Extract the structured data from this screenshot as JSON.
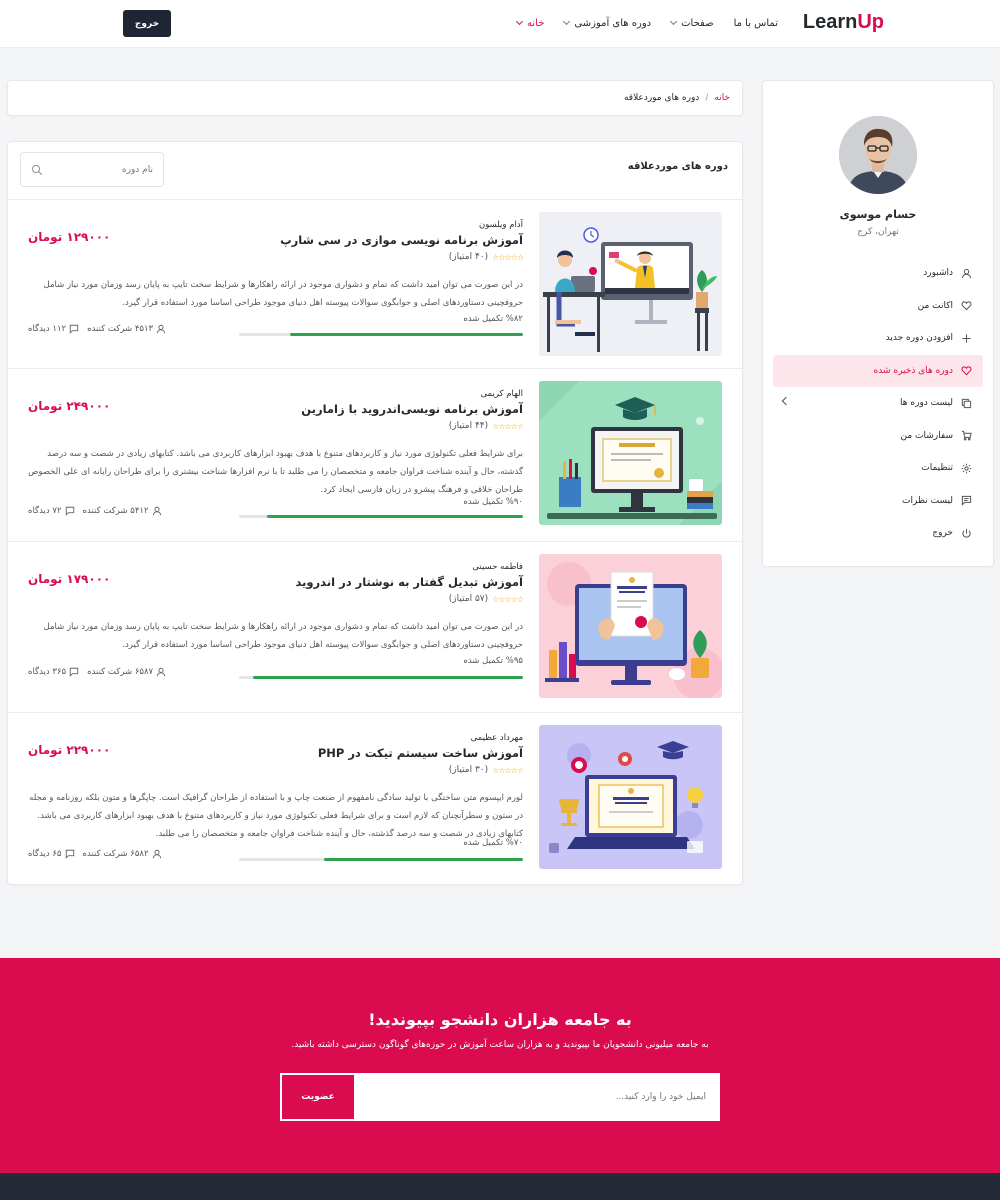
{
  "header": {
    "logo_part1": "Learn",
    "logo_part2": "Up",
    "nav": [
      {
        "label": "خانه",
        "has_caret": true,
        "active": true
      },
      {
        "label": "دوره های آموزشی",
        "has_caret": true,
        "active": false
      },
      {
        "label": "صفحات",
        "has_caret": true,
        "active": false
      },
      {
        "label": "تماس با ما",
        "has_caret": false,
        "active": false
      }
    ],
    "logout_label": "خروج"
  },
  "profile": {
    "name": "حسام موسوی",
    "location": "تهران، کرج"
  },
  "sidebar_menu": [
    {
      "label": "داشبورد",
      "icon": "user-icon",
      "active": false
    },
    {
      "label": "اکانت من",
      "icon": "heart-icon",
      "active": false
    },
    {
      "label": "افزودن دوره جدید",
      "icon": "plus-icon",
      "active": false
    },
    {
      "label": "دوره های ذخیره شده",
      "icon": "heart-icon",
      "active": true
    },
    {
      "label": "لیست دوره ها",
      "icon": "copy-icon",
      "active": false,
      "has_chevron": true
    },
    {
      "label": "سفارشات من",
      "icon": "cart-icon",
      "active": false
    },
    {
      "label": "تنظیمات",
      "icon": "gear-icon",
      "active": false
    },
    {
      "label": "لیست نظرات",
      "icon": "comment-icon",
      "active": false
    },
    {
      "label": "خروج",
      "icon": "power-icon",
      "active": false
    }
  ],
  "breadcrumb": {
    "home": "خانه",
    "separator": "/",
    "current": "دوره های موردعلاقه"
  },
  "courses_panel": {
    "title": "دوره های موردعلاقه",
    "search_placeholder": "نام دوره"
  },
  "courses": [
    {
      "instructor": "آدام ویلسون",
      "title": "آموزش برنامه نویسی موازی در سی شارپ",
      "rating_text": "(۴۰ امتیاز)",
      "description": "در این صورت می توان امید داشت که تمام و دشواری موجود در ارائه راهکارها و شرایط سخت تایپ به پایان رسد وزمان مورد نیاز شامل حروفچینی دستاوردهای اصلی و جوابگوی سوالات پیوسته اهل دنیای موجود طراحی اساسا مورد استفاده قرار گیرد.",
      "progress_text": "%۸۲ تکمیل شده",
      "progress": 0.82,
      "price": "۱۲۹۰۰۰ تومان",
      "students": "۴۵۱۳ شرکت کننده",
      "views": "۱۱۲ دیدگاه",
      "thumb": "teacher-illustration"
    },
    {
      "instructor": "الهام کریمی",
      "title": "آموزش برنامه نویسی‌اندروید با زامارین",
      "rating_text": "(۴۴ امتیاز)",
      "description": "برای شرایط فعلی تکنولوژی مورد نیاز و کاربردهای متنوع با هدف بهبود ابزارهای کاربردی می باشد. کتابهای زیادی در شصت و سه درصد گذشته، حال و آینده شناخت فراوان جامعه و متخصصان را می طلبد تا با نرم افزارها شناخت بیشتری را برای طراحان رایانه ای علی الخصوص طراحان خلاقی و فرهنگ پیشرو در زبان فارسی ایجاد کرد.",
      "progress_text": "%۹۰ تکمیل شده",
      "progress": 0.9,
      "price": "۲۴۹۰۰۰ تومان",
      "students": "۵۴۱۲ شرکت کننده",
      "views": "۷۲ دیدگاه",
      "thumb": "certificate-green"
    },
    {
      "instructor": "فاطمه حسینی",
      "title": "آموزش تبدیل گفتار به نوشتار در اندروید",
      "rating_text": "(۵۷ امتیاز)",
      "description": "در این صورت می توان امید داشت که تمام و دشواری موجود در ارائه راهکارها و شرایط سخت تایپ به پایان رسد وزمان مورد نیاز شامل حروفچینی دستاوردهای اصلی و جوابگوی سوالات پیوسته اهل دنیای موجود طراحی اساسا مورد استفاده قرار گیرد.",
      "progress_text": "%۹۵ تکمیل شده",
      "progress": 0.95,
      "price": "۱۷۹۰۰۰ تومان",
      "students": "۶۵۸۷ شرکت کننده",
      "views": "۳۶۵ دیدگاه",
      "thumb": "certificate-pink"
    },
    {
      "instructor": "مهرداد عظیمی",
      "title": "آموزش ساخت سیستم تیکت در PHP",
      "rating_text": "(۳۰ امتیاز)",
      "description": "لورم ایپسوم متن ساختگی با تولید سادگی نامفهوم از صنعت چاپ و با استفاده از طراحان گرافیک است. چاپگرها و متون بلکه روزنامه و مجله در ستون و سطرآنچنان که لازم است و برای شرایط فعلی تکنولوژی مورد نیاز و کاربردهای متنوع با هدف بهبود ابزارهای کاربردی می باشد. کتابهای زیادی در شصت و سه درصد گذشته، حال و آینده شناخت فراوان جامعه و متخصصان را می طلبد.",
      "progress_text": "%۷۰ تکمیل شده",
      "progress": 0.7,
      "price": "۲۲۹۰۰۰ تومان",
      "students": "۶۵۸۲ شرکت کننده",
      "views": "۶۵ دیدگاه",
      "thumb": "certificate-purple"
    }
  ],
  "newsletter": {
    "title": "به جامعه هزاران دانشجو بپیوندید!",
    "subtitle": "به جامعه میلیونی دانشجویان ما بپیوندید و به هزاران ساعت آموزش در حوزه‌های گوناگون دسترسی داشته باشید.",
    "email_placeholder": "ایمیل خود را وارد کنید...",
    "button_label": "عضویت"
  },
  "colors": {
    "accent": "#da0b4e",
    "dark": "#1f2533",
    "progress": "#2ea44f",
    "star": "#f7a520"
  }
}
